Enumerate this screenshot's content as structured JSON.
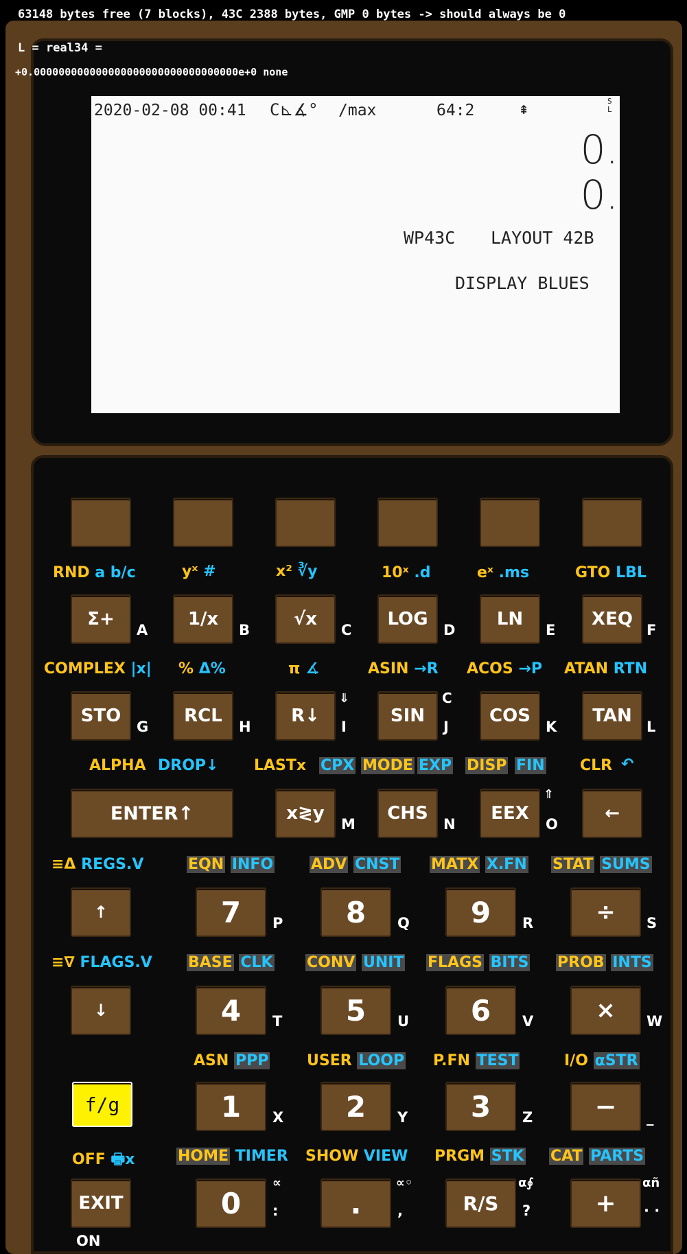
{
  "status_lines": {
    "line1": "63148 bytes free (7 blocks), 43C 2388 bytes, GMP 0 bytes -> should always be 0",
    "line2": "L = real34 =",
    "line3": "+0.000000000000000000000000000000000e+0 none"
  },
  "lcd": {
    "datetime": "2020-02-08 00:41",
    "mode_icons": "C⊾∡°",
    "max": "/max",
    "wordsize": "64:2",
    "arrow": "⇞",
    "sl": "S\nL",
    "stack_y": "0.",
    "stack_x": "0.",
    "info_left": "WP43C",
    "info_right": "LAYOUT 42B",
    "info2": "DISPLAY BLUES"
  },
  "row0_labels": [
    {
      "a": "RND",
      "b": "a b/c"
    },
    {
      "a": "yˣ",
      "b": "#"
    },
    {
      "a": "x²",
      "b": "∛y"
    },
    {
      "a": "10ˣ",
      "b": ".d"
    },
    {
      "a": "eˣ",
      "b": ".ms"
    },
    {
      "a": "GTO",
      "b": "LBL"
    }
  ],
  "row1": [
    {
      "key": "Σ+",
      "letter": "A"
    },
    {
      "key": "1/x",
      "letter": "B"
    },
    {
      "key": "√x",
      "letter": "C"
    },
    {
      "key": "LOG",
      "letter": "D"
    },
    {
      "key": "LN",
      "letter": "E"
    },
    {
      "key": "XEQ",
      "letter": "F"
    }
  ],
  "row1_labels": [
    {
      "a": "COMPLEX",
      "b": "|x|"
    },
    {
      "a": "%",
      "b": "Δ%"
    },
    {
      "a": "π",
      "b": "∡"
    },
    {
      "a": "ASIN",
      "b": "→R"
    },
    {
      "a": "ACOS",
      "b": "→P"
    },
    {
      "a": "ATAN",
      "b": "RTN"
    }
  ],
  "row2": [
    {
      "key": "STO",
      "letter": "G"
    },
    {
      "key": "RCL",
      "letter": "H"
    },
    {
      "key": "R↓",
      "letter": "I",
      "sup": "⇓"
    },
    {
      "key": "SIN",
      "letter": "J",
      "sup": "C"
    },
    {
      "key": "COS",
      "letter": "K"
    },
    {
      "key": "TAN",
      "letter": "L"
    }
  ],
  "row2_labels": {
    "alpha": "ALPHA",
    "drop": "DROP↓",
    "lastx": "LASTx",
    "cpx": "CPX",
    "mode": "MODE",
    "exp": "EXP",
    "disp": "DISP",
    "fin": "FIN",
    "clr": "CLR",
    "undo": "↶"
  },
  "row3": {
    "enter": "ENTER↑",
    "xy": "x≷y",
    "xy_letter": "M",
    "chs": "CHS",
    "chs_letter": "N",
    "eex": "EEX",
    "eex_letter": "O",
    "eex_sup": "⇑",
    "back": "←"
  },
  "row3_labels": [
    {
      "a": "≡Δ",
      "b": "REGS.V"
    },
    {
      "a": "EQN",
      "b": "INFO"
    },
    {
      "a": "ADV",
      "b": "CNST"
    },
    {
      "a": "MATX",
      "b": "X.FN"
    },
    {
      "a": "STAT",
      "b": "SUMS"
    }
  ],
  "row4": [
    {
      "key": "↑",
      "letter": ""
    },
    {
      "key": "7",
      "letter": "P"
    },
    {
      "key": "8",
      "letter": "Q"
    },
    {
      "key": "9",
      "letter": "R"
    },
    {
      "key": "÷",
      "letter": "S"
    }
  ],
  "row4_labels": [
    {
      "a": "≡∇",
      "b": "FLAGS.V"
    },
    {
      "a": "BASE",
      "b": "CLK"
    },
    {
      "a": "CONV",
      "b": "UNIT"
    },
    {
      "a": "FLAGS",
      "b": "BITS"
    },
    {
      "a": "PROB",
      "b": "INTS"
    }
  ],
  "row5": [
    {
      "key": "↓",
      "letter": ""
    },
    {
      "key": "4",
      "letter": "T"
    },
    {
      "key": "5",
      "letter": "U"
    },
    {
      "key": "6",
      "letter": "V"
    },
    {
      "key": "×",
      "letter": "W"
    }
  ],
  "row5_labels": [
    {
      "a": "ASN",
      "b": "PPP"
    },
    {
      "a": "USER",
      "b": "LOOP"
    },
    {
      "a": "P.FN",
      "b": "TEST"
    },
    {
      "a": "I/O",
      "b": "αSTR"
    }
  ],
  "row6": [
    {
      "key": "f/g",
      "letter": ""
    },
    {
      "key": "1",
      "letter": "X"
    },
    {
      "key": "2",
      "letter": "Y"
    },
    {
      "key": "3",
      "letter": "Z"
    },
    {
      "key": "−",
      "letter": "_"
    }
  ],
  "row6_labels": [
    {
      "a": "OFF",
      "b": "🖶x"
    },
    {
      "a": "HOME",
      "b": "TIMER"
    },
    {
      "a": "SHOW",
      "b": "VIEW"
    },
    {
      "a": "PRGM",
      "b": "STK"
    },
    {
      "a": "CAT",
      "b": "PARTS"
    }
  ],
  "row7": [
    {
      "key": "EXIT",
      "letter": "ON"
    },
    {
      "key": "0",
      "letter": ":",
      "sup": "∝"
    },
    {
      "key": ".",
      "letter": ",",
      "sup": "∝◦"
    },
    {
      "key": "R/S",
      "letter": "?",
      "sup": "α∮"
    },
    {
      "key": "+",
      "letter": "· ·",
      "sup": "αñ"
    }
  ]
}
